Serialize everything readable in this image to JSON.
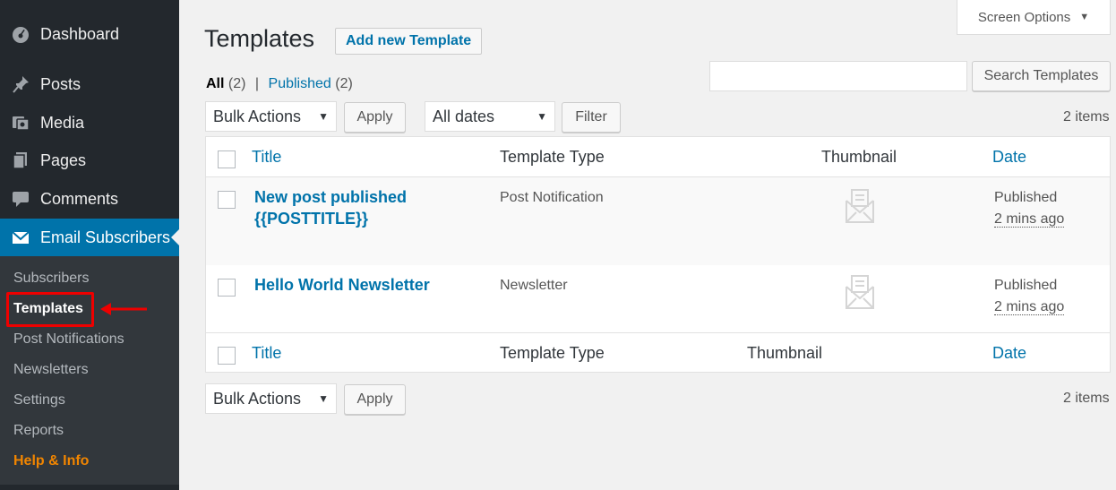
{
  "sidebar": {
    "items": [
      {
        "label": "Dashboard",
        "icon": "dashboard-icon"
      },
      {
        "label": "Posts",
        "icon": "pin-icon"
      },
      {
        "label": "Media",
        "icon": "media-icon"
      },
      {
        "label": "Pages",
        "icon": "pages-icon"
      },
      {
        "label": "Comments",
        "icon": "comments-icon"
      },
      {
        "label": "Email Subscribers",
        "icon": "envelope-icon"
      }
    ],
    "submenu": [
      "Subscribers",
      "Templates",
      "Post Notifications",
      "Newsletters",
      "Settings",
      "Reports",
      "Help & Info"
    ],
    "current_submenu": "Templates"
  },
  "header": {
    "screen_options": "Screen Options",
    "title": "Templates",
    "add_new": "Add new Template"
  },
  "views": {
    "all_label": "All",
    "all_count": "(2)",
    "separator": "|",
    "published_label": "Published",
    "published_count": "(2)"
  },
  "search": {
    "button": "Search Templates",
    "value": ""
  },
  "toolbar_top": {
    "bulk_actions": "Bulk Actions",
    "apply": "Apply",
    "dates": "All dates",
    "filter": "Filter",
    "items_count": "2 items"
  },
  "table": {
    "columns": {
      "title": "Title",
      "type": "Template Type",
      "thumbnail": "Thumbnail",
      "date": "Date"
    },
    "rows": [
      {
        "title_line1": "New post published",
        "title_line2": "{{POSTTITLE}}",
        "type": "Post Notification",
        "status": "Published",
        "ago": "2 mins ago"
      },
      {
        "title_line1": "Hello World Newsletter",
        "title_line2": "",
        "type": "Newsletter",
        "status": "Published",
        "ago": "2 mins ago"
      }
    ]
  },
  "toolbar_bottom": {
    "bulk_actions": "Bulk Actions",
    "apply": "Apply",
    "items_count": "2 items"
  },
  "colors": {
    "sidebar_bg": "#23282d",
    "active_menu": "#0073aa",
    "link": "#0073aa",
    "highlight": "#e00000",
    "help": "#f18500"
  }
}
